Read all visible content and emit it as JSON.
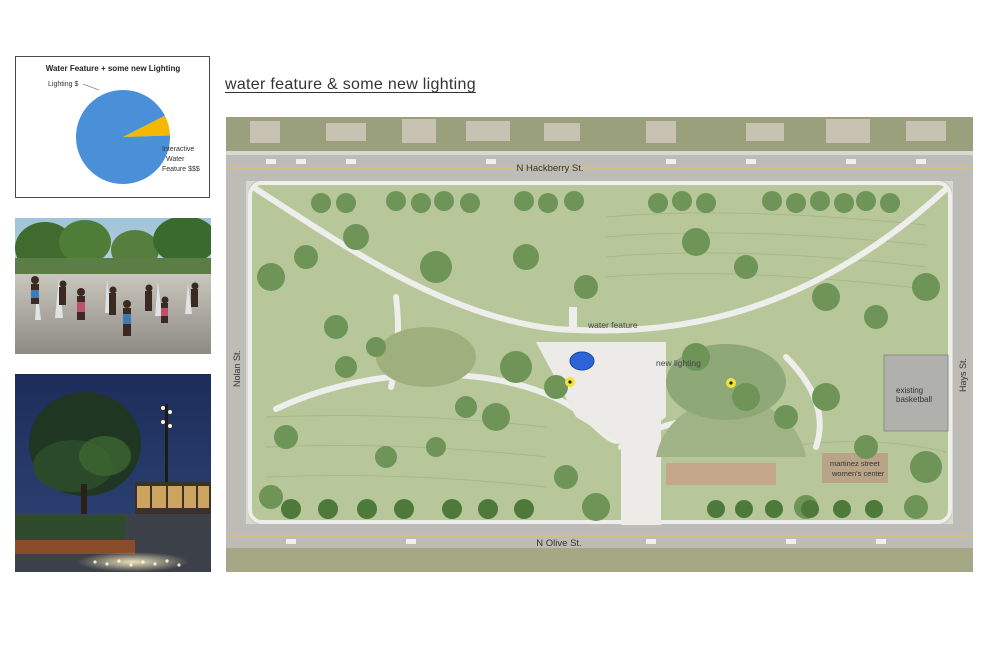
{
  "heading": "water feature & some new lighting",
  "chart_data": {
    "type": "pie",
    "title": "Water Feature + some new Lighting",
    "slices": [
      {
        "label": "Lighting $",
        "value": 7,
        "color": "#f5b800"
      },
      {
        "label": "Interactive Water Feature $$$",
        "value": 93,
        "color": "#4a90d9"
      }
    ],
    "label_lines": {
      "lighting": [
        "Lighting $"
      ],
      "water": [
        "Interactive",
        "Water",
        "Feature $$$"
      ]
    },
    "start_angle_deg": -27,
    "legend": "none"
  },
  "photos": {
    "splash_pad": "splash pad photo",
    "night_plaza": "night lighting photo"
  },
  "plan": {
    "streets": {
      "north": "N Hackberry St.",
      "south": "N Olive St.",
      "west": "Nolan St.",
      "east": "Hays St."
    },
    "labels": {
      "water_feature": "water feature",
      "new_lighting": "new lighting",
      "basketball": [
        "existing",
        "basketball"
      ],
      "womens_center": [
        "martinez street",
        "women's center"
      ]
    },
    "colors": {
      "lawn": "#b7c79a",
      "path": "#eeeeec",
      "water": "#2f63d8",
      "light": "#f3e23a",
      "tree": "#6f9457"
    }
  }
}
